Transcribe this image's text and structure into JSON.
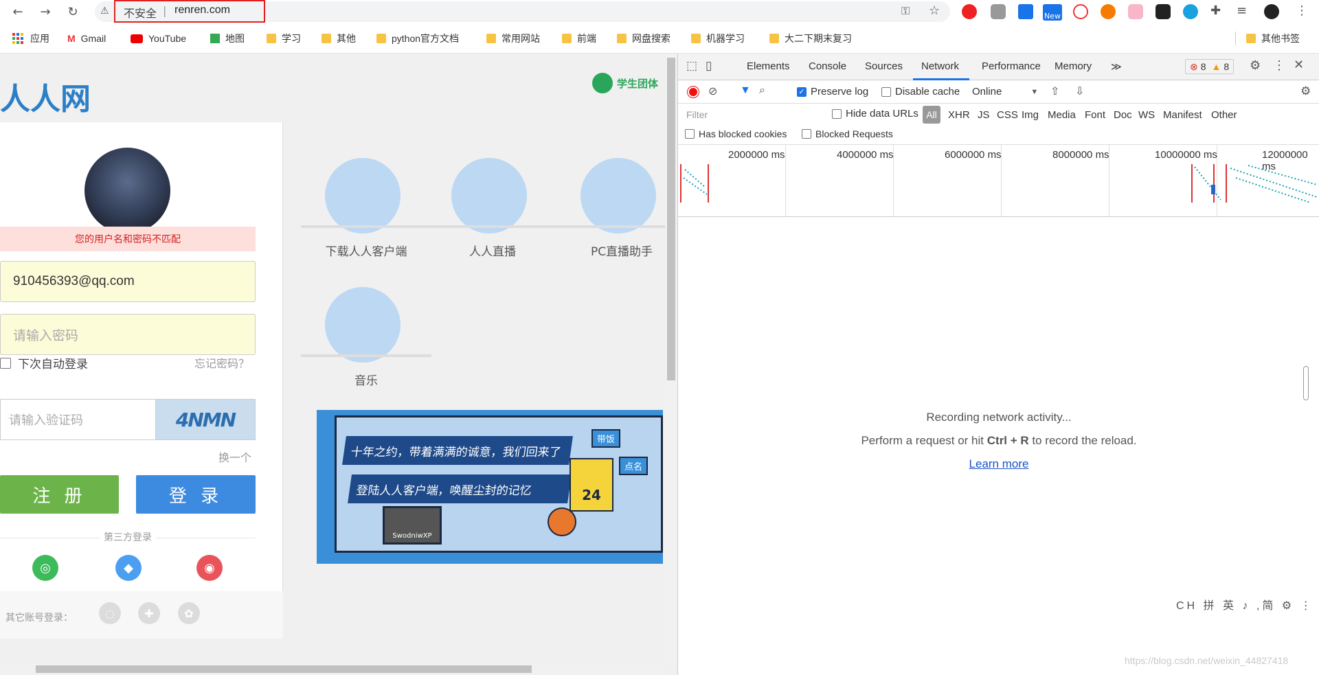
{
  "browser": {
    "security_label": "不安全",
    "separator": "|",
    "url": "renren.com",
    "extensions": {
      "new_badge": "New"
    }
  },
  "bookmarks": {
    "apps": "应用",
    "items": [
      "Gmail",
      "YouTube",
      "地图",
      "学习",
      "其他",
      "python官方文档",
      "常用网站",
      "前端",
      "网盘搜索",
      "机器学习",
      "大二下期末复习"
    ],
    "other": "其他书签"
  },
  "page": {
    "logo": "人人网",
    "student_link": "学生团体",
    "error_message": "您的用户名和密码不匹配",
    "email_value": "910456393@qq.com",
    "password_placeholder": "请输入密码",
    "remember_label": "下次自动登录",
    "forgot_label": "忘记密码？",
    "captcha_placeholder": "请输入验证码",
    "captcha_image_text": "4NMN",
    "refresh_label": "换一个",
    "register_label": "注 册",
    "login_label": "登 录",
    "third_party_title": "第三方登录",
    "other_accounts_label": "其它账号登录：",
    "features": [
      "下载人人客户端",
      "人人直播",
      "PC直播助手",
      "音乐"
    ],
    "banner": {
      "line1": "十年之约，带着满满的诚意，我们回来了",
      "line2": "登陆人人客户端，唤醒尘封的记忆",
      "tag1": "带饭",
      "tag2": "点名",
      "jersey_number": "24",
      "winxp": "SwodniwXP"
    }
  },
  "devtools": {
    "tabs": [
      "Elements",
      "Console",
      "Sources",
      "Network",
      "Performance",
      "Memory"
    ],
    "more": "≫",
    "errors": "8",
    "warnings": "8",
    "preserve_log": "Preserve log",
    "disable_cache": "Disable cache",
    "throttle": "Online",
    "filter_placeholder": "Filter",
    "hide_data_urls": "Hide data URLs",
    "types": [
      "All",
      "XHR",
      "JS",
      "CSS",
      "Img",
      "Media",
      "Font",
      "Doc",
      "WS",
      "Manifest",
      "Other"
    ],
    "has_blocked_cookies": "Has blocked cookies",
    "blocked_requests": "Blocked Requests",
    "ticks": [
      "2000000 ms",
      "4000000 ms",
      "6000000 ms",
      "8000000 ms",
      "10000000 ms",
      "12000000 ms"
    ],
    "empty_line1": "Recording network activity...",
    "empty_line2_pre": "Perform a request or hit ",
    "empty_line2_key": "Ctrl + R",
    "empty_line2_post": " to record the reload.",
    "learn_more": "Learn more",
    "ime": "CH 拼 英 ♪ ,简 ⚙ ⋮",
    "watermark": "https://blog.csdn.net/weixin_44827418"
  },
  "colors": {
    "accent": "#1a73e8",
    "register": "#6cb449",
    "login": "#3d8be0",
    "error_bg": "#fde0dc"
  }
}
